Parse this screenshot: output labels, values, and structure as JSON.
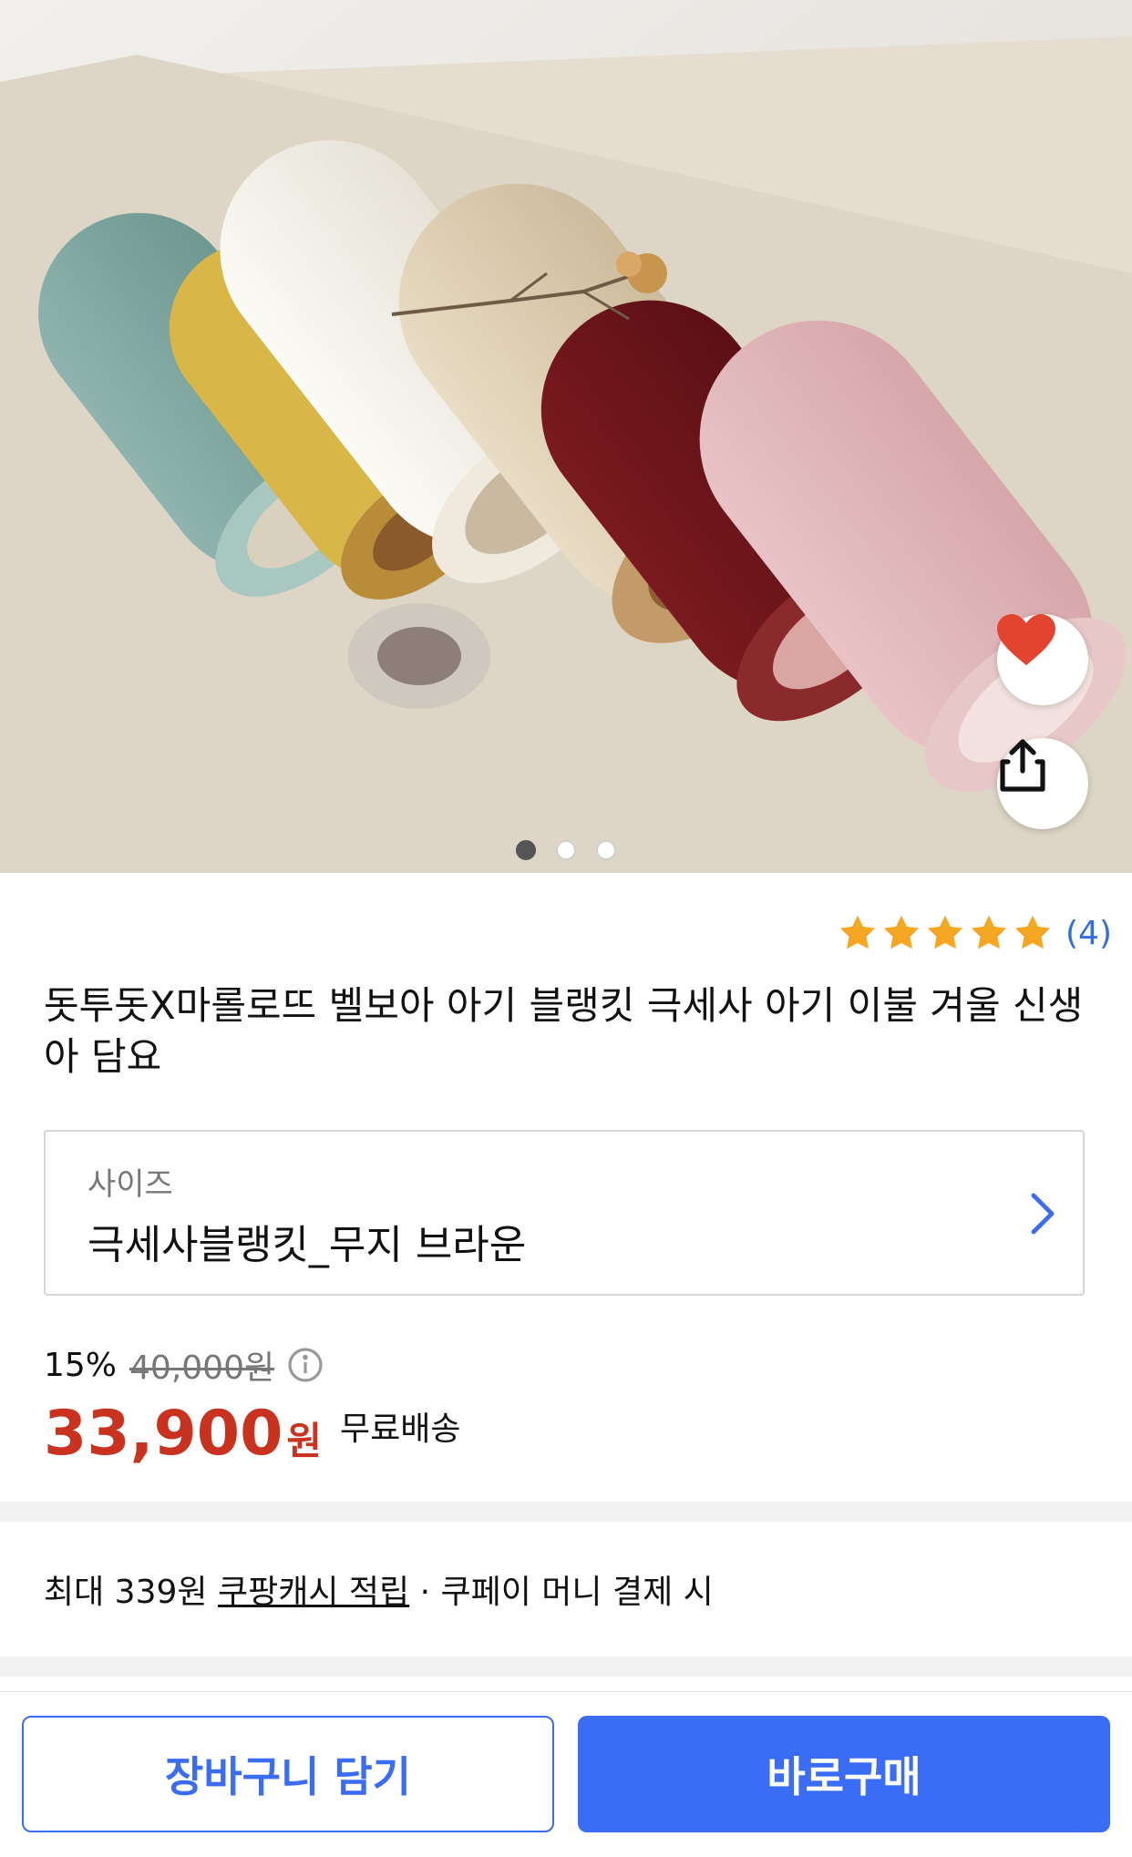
{
  "product": {
    "image_alt": "Rolled fleece baby blankets in green, yellow, white, beige, grey, burgundy and pink",
    "image_page_count": 3,
    "image_page_active": 1,
    "rating_stars": 5,
    "rating_count": "(4)",
    "title": "돗투돗X마롤로뜨 벨보아 아기 블랭킷 극세사 아기 이불 겨울 신생아 담요"
  },
  "option": {
    "label": "사이즈",
    "value": "극세사블랭킷_무지 브라운"
  },
  "price": {
    "discount": "15%",
    "original": "40,000원",
    "sale": "33,900",
    "unit": "원",
    "shipping": "무료배송"
  },
  "cashback": {
    "prefix": "최대 339원 ",
    "link": "쿠팡캐시 적립",
    "suffix": " · 쿠페이 머니 결제 시"
  },
  "actions": {
    "cart": "장바구니 담기",
    "buy": "바로구매"
  },
  "colors": {
    "accent": "#3b6cf6",
    "price": "#c8321f",
    "star": "#f5a623",
    "heart": "#e2442f"
  }
}
